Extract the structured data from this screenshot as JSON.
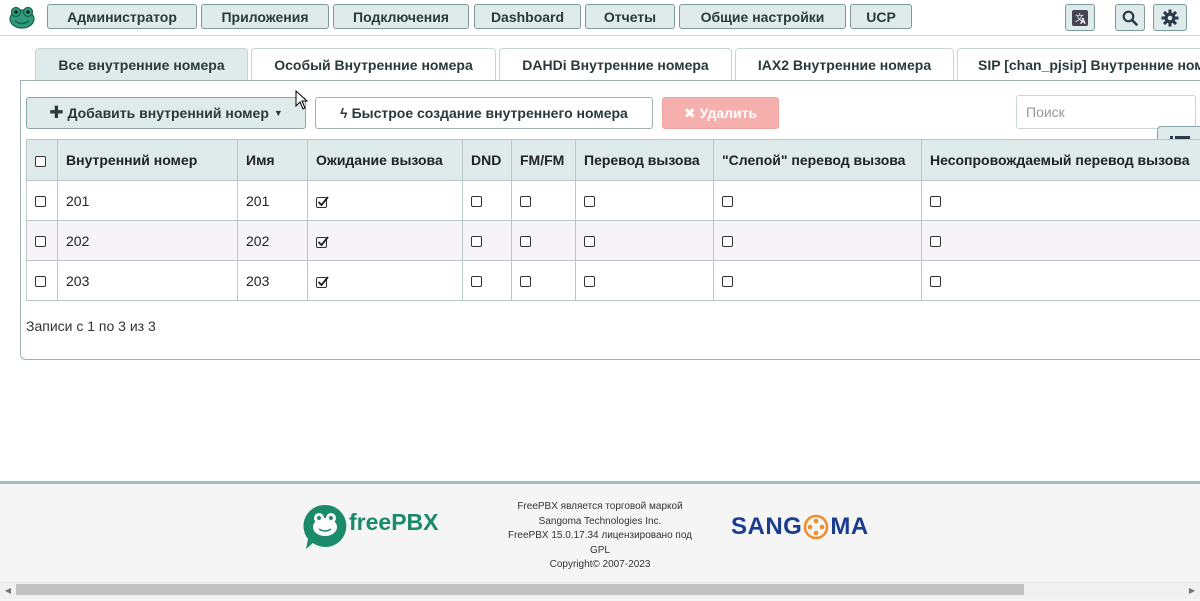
{
  "nav": {
    "items": [
      "Администратор",
      "Приложения",
      "Подключения",
      "Dashboard",
      "Отчеты",
      "Общие настройки",
      "UCP"
    ]
  },
  "tabs": [
    "Все внутренние номера",
    "Особый Внутренние номера",
    "DAHDi Внутренние номера",
    "IAX2 Внутренние номера",
    "SIP [chan_pjsip] Внутренние номера"
  ],
  "toolbar": {
    "add_label": "Добавить внутренний номер",
    "quick_label": "Быстрое создание внутреннего номера",
    "delete_label": "Удалить",
    "search_placeholder": "Поиск"
  },
  "table": {
    "columns": [
      "Внутренний номер",
      "Имя",
      "Ожидание вызова",
      "DND",
      "FM/FM",
      "Перевод вызова",
      "\"Слепой\" перевод вызова",
      "Несопровождаемый перевод вызова"
    ],
    "rows": [
      {
        "ext": "201",
        "name": "201",
        "call_waiting": true,
        "dnd": false,
        "fmfm": false,
        "cf": false,
        "blind": false,
        "unattended": false
      },
      {
        "ext": "202",
        "name": "202",
        "call_waiting": true,
        "dnd": false,
        "fmfm": false,
        "cf": false,
        "blind": false,
        "unattended": false
      },
      {
        "ext": "203",
        "name": "203",
        "call_waiting": true,
        "dnd": false,
        "fmfm": false,
        "cf": false,
        "blind": false,
        "unattended": false
      }
    ],
    "info": "Записи с 1 по 3 из 3"
  },
  "footer": {
    "freepbx_logo": "freePBX",
    "text_lines": [
      "FreePBX является торговой маркой",
      "Sangoma Technologies Inc.",
      "FreePBX 15.0.17.34 лицензировано под",
      "GPL",
      "Copyright© 2007-2023"
    ],
    "sangoma_left": "SANG",
    "sangoma_right": "MA"
  },
  "colors": {
    "accent": "#dfeaea",
    "border": "#7c9a9a",
    "danger": "#f5b0ae",
    "brand_green": "#1b8a6b",
    "sangoma_blue": "#1a3d8f",
    "sangoma_orange": "#f28c28"
  },
  "icons": {
    "logo": "freepbx-frog-icon",
    "language": "language-icon",
    "search": "search-icon",
    "settings": "gear-icon",
    "columns": "list-icon"
  }
}
